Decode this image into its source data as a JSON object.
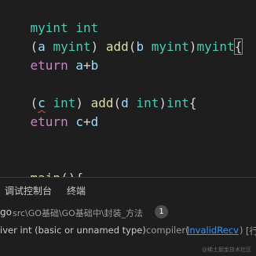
{
  "code": {
    "l1": {
      "a": "myint",
      "b": " ",
      "c": "int"
    },
    "l2": {
      "a": "(",
      "b": "a",
      "c": " ",
      "d": "myint",
      "e": ") ",
      "f": "add",
      "g": "(",
      "h": "b",
      "i": " ",
      "j": "myint",
      "k": ")",
      "l": "myint",
      "m": "{"
    },
    "l3": {
      "a": "eturn",
      "b": " ",
      "c": "a",
      "d": "+",
      "e": "b"
    },
    "l5": {
      "a": "(",
      "b": "c",
      "c": " ",
      "d": "int",
      "e": ") ",
      "f": "add",
      "g": "(",
      "h": "d",
      "i": " ",
      "j": "int",
      "k": ")",
      "l": "int",
      "m": "{"
    },
    "l6": {
      "a": "eturn",
      "b": " ",
      "c": "c",
      "d": "+",
      "e": "d"
    },
    "l9": {
      "a": "main",
      "b": "(){"
    }
  },
  "panel": {
    "tab_debug": "调试控制台",
    "tab_terminal": "终端",
    "problem_lang": "go",
    "problem_path": "src\\GO基础\\GO基础中\\封装_方法",
    "problem_count": "1",
    "error_text": "iver int (basic or unnamed type)",
    "error_source": "compiler(",
    "error_code": "InvalidRecv",
    "error_close": ")",
    "error_location": "[行"
  },
  "watermark": "@稀土掘金技术社区"
}
